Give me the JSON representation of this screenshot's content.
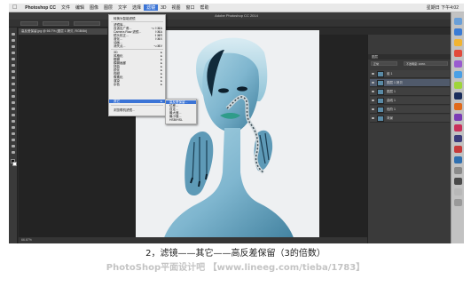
{
  "menubar": {
    "app_name": "Photoshop CC",
    "items": [
      "文件",
      "编辑",
      "图像",
      "图层",
      "文字",
      "选择",
      "滤镜",
      "3D",
      "视图",
      "窗口",
      "帮助"
    ],
    "active_item": "滤镜",
    "clock": "星期日 下午4:02"
  },
  "window_title": "Adobe Photoshop CC 2014",
  "document_tab": "高反差保留.jpg @ 66.7% (图层 1 拷贝, RGB/8#)",
  "status": {
    "zoom": "66.67%"
  },
  "filter_menu": {
    "items": [
      {
        "label": "转换为智能滤镜",
        "shortcut": ""
      },
      {
        "label": "滤镜库...",
        "shortcut": ""
      },
      {
        "label": "自适应广角...",
        "shortcut": "⌥⇧⌘A"
      },
      {
        "label": "Camera Raw 滤镜...",
        "shortcut": "⇧⌘A"
      },
      {
        "label": "镜头校正...",
        "shortcut": "⇧⌘R"
      },
      {
        "label": "液化...",
        "shortcut": "⇧⌘X"
      },
      {
        "label": "油画...",
        "shortcut": ""
      },
      {
        "label": "消失点...",
        "shortcut": "⌥⌘V"
      },
      {
        "label": "3D",
        "shortcut": "▸"
      },
      {
        "label": "风格化",
        "shortcut": "▸"
      },
      {
        "label": "模糊",
        "shortcut": "▸"
      },
      {
        "label": "模糊画廊",
        "shortcut": "▸"
      },
      {
        "label": "扭曲",
        "shortcut": "▸"
      },
      {
        "label": "锐化",
        "shortcut": "▸"
      },
      {
        "label": "视频",
        "shortcut": "▸"
      },
      {
        "label": "像素化",
        "shortcut": "▸"
      },
      {
        "label": "渲染",
        "shortcut": "▸"
      },
      {
        "label": "杂色",
        "shortcut": "▸"
      },
      {
        "label": "其它",
        "shortcut": "▸"
      },
      {
        "label": "浏览联机滤镜...",
        "shortcut": ""
      }
    ],
    "selected": "其它"
  },
  "other_submenu": {
    "items": [
      "高反差保留...",
      "位移...",
      "自定...",
      "最大值...",
      "最小值...",
      "HSB/HSL"
    ],
    "selected": "高反差保留..."
  },
  "layers_panel": {
    "title": "图层",
    "blend_mode": "正常",
    "opacity": "不透明度: 100%",
    "layers": [
      {
        "name": "组 1",
        "selected": false
      },
      {
        "name": "图层 1 拷贝",
        "selected": true
      },
      {
        "name": "图层 1",
        "selected": false
      },
      {
        "name": "曲线 1",
        "selected": false
      },
      {
        "name": "色阶 1",
        "selected": false
      },
      {
        "name": "背景",
        "selected": false
      }
    ]
  },
  "caption": "2，滤镜——其它——高反差保留（3的倍数）",
  "watermark": "PhotoShop平面设计吧 【www.lineeg.com/tieba/1783】",
  "colors": {
    "ps_dark": "#2b2b2b",
    "menu_highlight": "#3b74d6",
    "image_skin": "#7fb6cf",
    "image_background": "#eef0f2"
  }
}
